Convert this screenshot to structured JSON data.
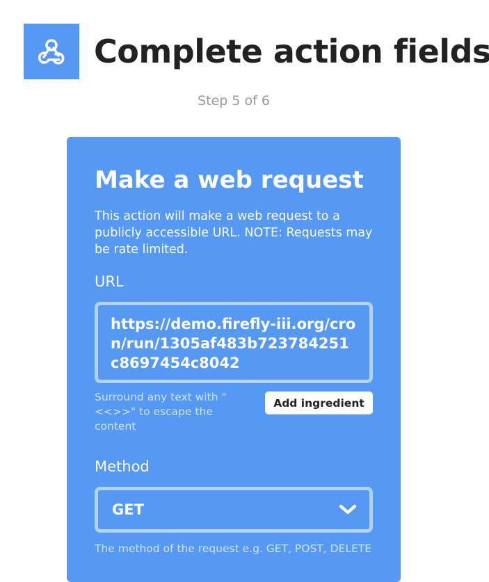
{
  "header": {
    "title": "Complete action fields",
    "logo_icon": "webhooks-icon",
    "step": "Step 5 of 6"
  },
  "card": {
    "title": "Make a web request",
    "description": "This action will make a web request to a publicly accessible URL. NOTE: Requests may be rate limited.",
    "url_field": {
      "label": "URL",
      "value": "https://demo.firefly-iii.org/cron/run/1305af483b723784251c8697454c8042",
      "helper": "Surround any text with \"<<>>\" to escape the content",
      "add_ingredient_label": "Add ingredient"
    },
    "method_field": {
      "label": "Method",
      "selected": "GET",
      "helper": "The method of the request e.g. GET, POST, DELETE",
      "chevron_icon": "chevron-down-icon"
    }
  },
  "colors": {
    "accent": "#5599f5",
    "title": "#222222",
    "muted": "#999999"
  }
}
